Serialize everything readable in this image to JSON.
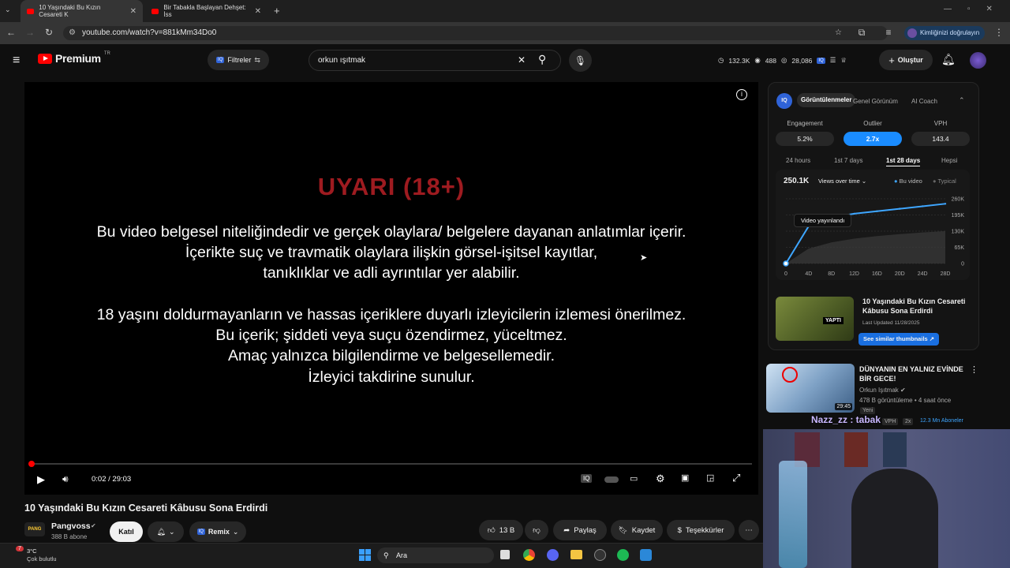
{
  "browser": {
    "tabs": [
      {
        "title": "10 Yaşındaki Bu Kızın Cesareti K",
        "active": true
      },
      {
        "title": "Bir Tabakla Başlayan Dehşet: İss",
        "active": false
      }
    ],
    "url": "youtube.com/watch?v=881kMm34Do0",
    "verify_label": "Kimliğinizi doğrulayın"
  },
  "header": {
    "brand": "Premium",
    "region": "TR",
    "filter_label": "Filtreler",
    "search_value": "orkun ışıtmak",
    "stats": {
      "views": "132.3K",
      "watch": "488",
      "subs": "28,086"
    },
    "create_label": "Oluştur"
  },
  "player": {
    "warning_title": "UYARI (18+)",
    "lines1": [
      "Bu video belgesel niteliğindedir ve gerçek olaylara/ belgelere dayanan anlatımlar içerir.",
      "İçerikte suç ve travmatik olaylara ilişkin görsel-işitsel kayıtlar,",
      "tanıklıklar ve adli ayrıntılar yer alabilir."
    ],
    "lines2": [
      "18 yaşını doldurmayanların ve hassas içeriklere duyarlı izleyicilerin izlemesi önerilmez.",
      "Bu içerik; şiddeti veya suçu özendirmez, yüceltmez.",
      "Amaç yalnızca bilgilendirme ve belgesellemedir.",
      "İzleyici takdirine sunulur."
    ],
    "time": "0:02 / 29:03",
    "progress": 0.001
  },
  "video": {
    "title": "10 Yaşındaki Bu Kızın Cesareti Kâbusu Sona Erdirdi",
    "channel": "Pangvoss",
    "subs": "388 B abone",
    "join_label": "Katıl",
    "remix_label": "Remix",
    "likes": "13 B",
    "share_label": "Paylaş",
    "save_label": "Kaydet",
    "thanks_label": "Teşekkürler"
  },
  "vidiq": {
    "tabs": [
      "Görüntülenmeler",
      "Genel Görünüm",
      "AI Coach"
    ],
    "metrics": [
      {
        "label": "Engagement",
        "value": "5.2%"
      },
      {
        "label": "Outlier",
        "value": "2.7x"
      },
      {
        "label": "VPH",
        "value": "143.4"
      }
    ],
    "ranges": [
      "24 hours",
      "1st 7 days",
      "1st 28 days",
      "Hepsi"
    ],
    "total": "250.1K",
    "dropdown": "Views over time",
    "legend": [
      "Bu video",
      "Typical"
    ],
    "tooltip": "Video yayınlandı",
    "accent": "#3ea6ff"
  },
  "chart_data": {
    "type": "line",
    "x": [
      "0",
      "4D",
      "8D",
      "12D",
      "16D",
      "20D",
      "24D",
      "28D"
    ],
    "yticks": [
      "260K",
      "195K",
      "130K",
      "65K",
      "0"
    ],
    "ylim": [
      0,
      260000
    ],
    "series": [
      {
        "name": "Bu video",
        "values": [
          0,
          150000,
          185000,
          200000,
          210000,
          220000,
          230000,
          240000
        ]
      },
      {
        "name": "Typical",
        "values": [
          0,
          60000,
          85000,
          100000,
          110000,
          118000,
          125000,
          130000
        ]
      }
    ]
  },
  "similar": {
    "title": "10 Yaşındaki Bu Kızın Cesareti Kâbusu Sona Erdirdi",
    "updated": "Last Updated 11/28/2025",
    "button": "See similar thumbnails",
    "thumb_text": "YAPTI"
  },
  "recommendation": {
    "title": "DÜNYANIN EN YALNIZ EVİNDE BİR GECE!",
    "channel": "Orkun Işıtmak",
    "meta": "478 B görüntüleme • 4 saat önce",
    "badge": "Yeni",
    "duration": "29:45",
    "vph": "VPH",
    "multiplier": "2x",
    "subs": "12.3 Mn Aboneler"
  },
  "overlay": {
    "chat": "Nazz_zz : tabak"
  },
  "taskbar": {
    "temp": "3°C",
    "weather": "Çok bulutlu",
    "search": "Ara",
    "notif": "7"
  }
}
